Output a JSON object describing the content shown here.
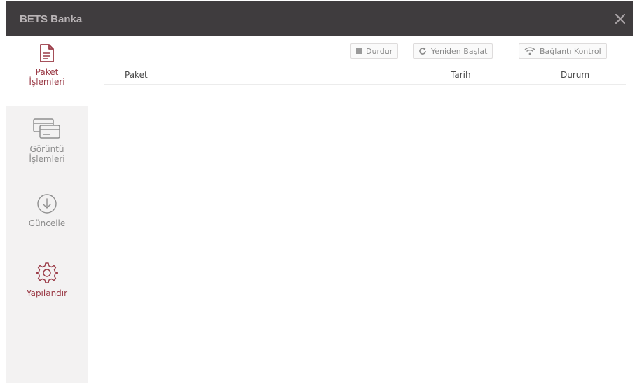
{
  "window": {
    "title": "BETS Banka"
  },
  "sidebar": {
    "items": [
      {
        "label_line1": "Paket",
        "label_line2": "İşlemleri",
        "icon": "document-icon"
      },
      {
        "label_line1": "Görüntü",
        "label_line2": "İşlemleri",
        "icon": "cards-icon"
      },
      {
        "label_line1": "Güncelle",
        "icon": "download-circle-icon"
      },
      {
        "label_line1": "Yapılandır",
        "icon": "gear-icon"
      }
    ]
  },
  "toolbar": {
    "stop_label": "Durdur",
    "restart_label": "Yeniden Başlat",
    "connection_label": "Bağlantı Kontrol"
  },
  "table": {
    "headers": [
      "Paket",
      "Tarih",
      "Durum"
    ],
    "rows": []
  },
  "colors": {
    "titlebar": "#3f3c3e",
    "accent": "#9a3a46",
    "sidebar_bg": "#f3f2f2"
  }
}
